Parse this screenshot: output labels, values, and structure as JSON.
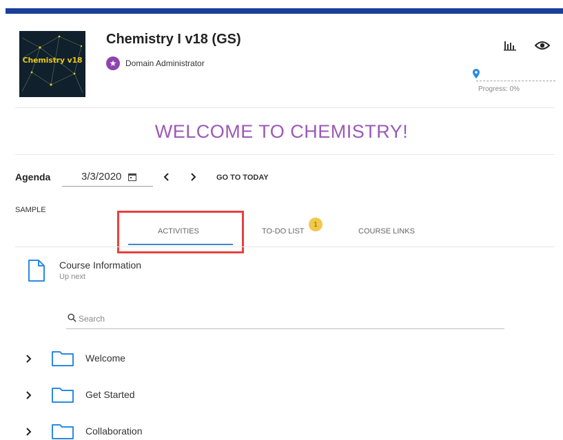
{
  "course": {
    "thumbnail_text": "Chemistry v18",
    "title": "Chemistry I v18 (GS)",
    "role": "Domain Administrator"
  },
  "header_icons": {
    "stats": "bar-chart-icon",
    "preview": "eye-icon"
  },
  "progress": {
    "label": "Progress: 0%",
    "value_percent": 0
  },
  "welcome": "WELCOME TO CHEMISTRY!",
  "agenda": {
    "label": "Agenda",
    "date": "3/3/2020",
    "goto_today": "GO TO TODAY"
  },
  "section_label": "SAMPLE",
  "tabs": [
    {
      "label": "ACTIVITIES",
      "active": true
    },
    {
      "label": "TO-DO LIST",
      "badge": "1"
    },
    {
      "label": "COURSE LINKS"
    }
  ],
  "up_next": {
    "title": "Course Information",
    "subtitle": "Up next"
  },
  "search": {
    "placeholder": "Search"
  },
  "folders": [
    {
      "label": "Welcome"
    },
    {
      "label": "Get Started"
    },
    {
      "label": "Collaboration"
    }
  ],
  "colors": {
    "top_bar": "#1a3f99",
    "welcome": "#9b59b6",
    "accent": "#4285c8",
    "highlight": "#e8403d",
    "badge": "#f2c84b",
    "role_badge": "#8e44ad"
  }
}
